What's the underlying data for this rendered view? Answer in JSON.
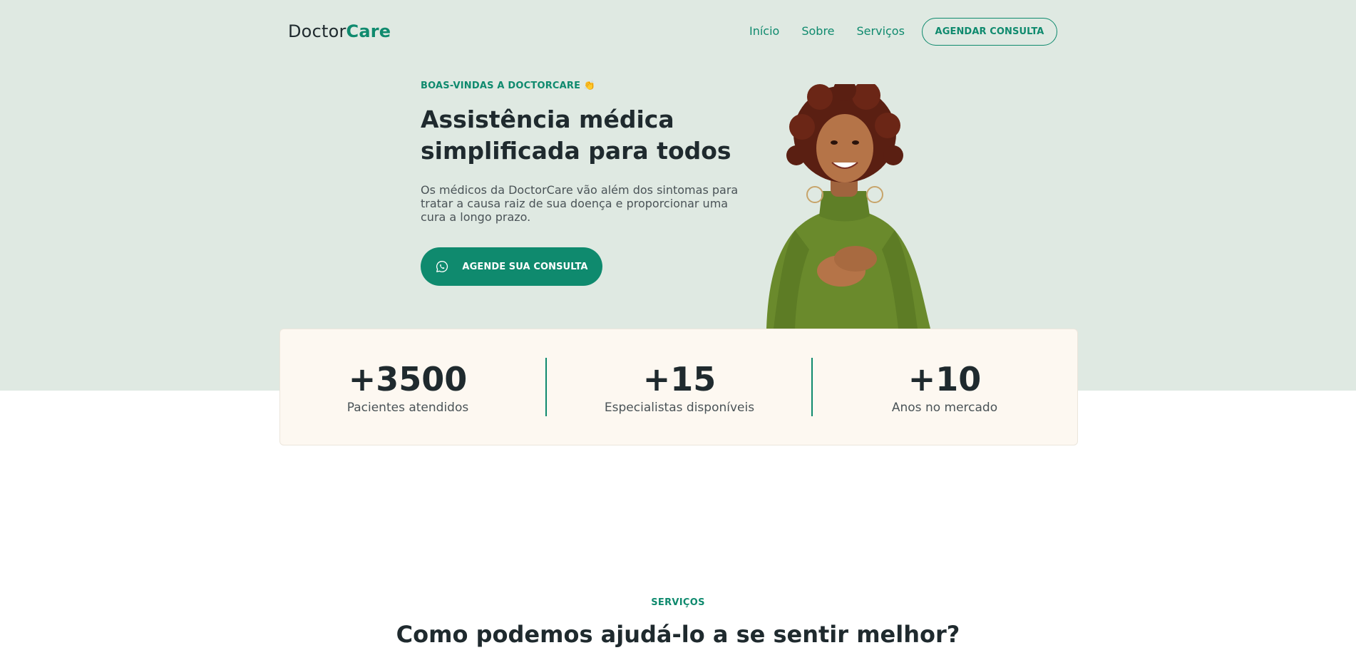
{
  "header": {
    "logo_primary": "Doctor",
    "logo_accent": "Care",
    "nav": [
      "Início",
      "Sobre",
      "Serviços"
    ],
    "cta": "AGENDAR CONSULTA"
  },
  "hero": {
    "eyebrow": "BOAS-VINDAS A DOCTORCARE 👏",
    "title_line1": "Assistência médica",
    "title_line2": "simplificada para todos",
    "text": "Os médicos da DoctorCare vão além dos sintomas para tratar a causa raiz de sua doença e proporcionar uma cura a longo prazo.",
    "button": "AGENDE SUA CONSULTA",
    "button_icon": "whatsapp-icon"
  },
  "stats": [
    {
      "value": "+3500",
      "label": "Pacientes atendidos"
    },
    {
      "value": "+15",
      "label": "Especialistas disponíveis"
    },
    {
      "value": "+10",
      "label": "Anos no mercado"
    }
  ],
  "services": {
    "eyebrow": "SERVIÇOS",
    "title": "Como podemos ajudá-lo a se sentir melhor?"
  },
  "colors": {
    "accent": "#0f8a6e",
    "hero_bg": "#dfe9e2",
    "card_bg": "#fdf8f1"
  }
}
